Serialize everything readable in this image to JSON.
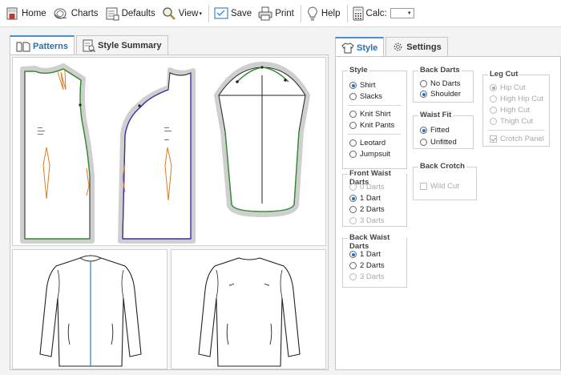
{
  "toolbar": {
    "home": "Home",
    "charts": "Charts",
    "defaults": "Defaults",
    "view": "View",
    "save": "Save",
    "print": "Print",
    "help": "Help",
    "calc": "Calc:",
    "calc_value": ""
  },
  "left_tabs": {
    "patterns": "Patterns",
    "style_summary": "Style Summary"
  },
  "right_tabs": {
    "style": "Style",
    "settings": "Settings"
  },
  "style_group": {
    "title": "Style",
    "options": [
      "Shirt",
      "Slacks",
      "Knit Shirt",
      "Knit Pants",
      "Leotard",
      "Jumpsuit"
    ],
    "selected": "Shirt"
  },
  "front_waist_darts": {
    "title": "Front Waist Darts",
    "options": [
      "0 Darts",
      "1 Dart",
      "2 Darts",
      "3 Darts"
    ],
    "selected": "1 Dart"
  },
  "back_waist_darts": {
    "title": "Back Waist Darts",
    "options": [
      "1 Dart",
      "2 Darts",
      "3 Darts"
    ],
    "selected": "1 Dart"
  },
  "back_darts": {
    "title": "Back Darts",
    "options": [
      "No Darts",
      "Shoulder"
    ],
    "selected": "Shoulder"
  },
  "waist_fit": {
    "title": "Waist Fit",
    "options": [
      "Fitted",
      "Unfitted"
    ],
    "selected": "Fitted"
  },
  "back_crotch": {
    "title": "Back Crotch",
    "wild_cut": "Wild Cut"
  },
  "leg_cut": {
    "title": "Leg Cut",
    "options": [
      "Hip Cut",
      "High Hip Cut",
      "High Cut",
      "Thigh Cut"
    ],
    "selected": "Hip Cut",
    "crotch_panel": "Crotch Panel"
  },
  "colors": {
    "accent": "#2a6fb0",
    "front_seam": "#2e8b2e",
    "back_seam": "#3b2fb0",
    "dart": "#e07b20",
    "center_line": "#2a7fc0"
  }
}
